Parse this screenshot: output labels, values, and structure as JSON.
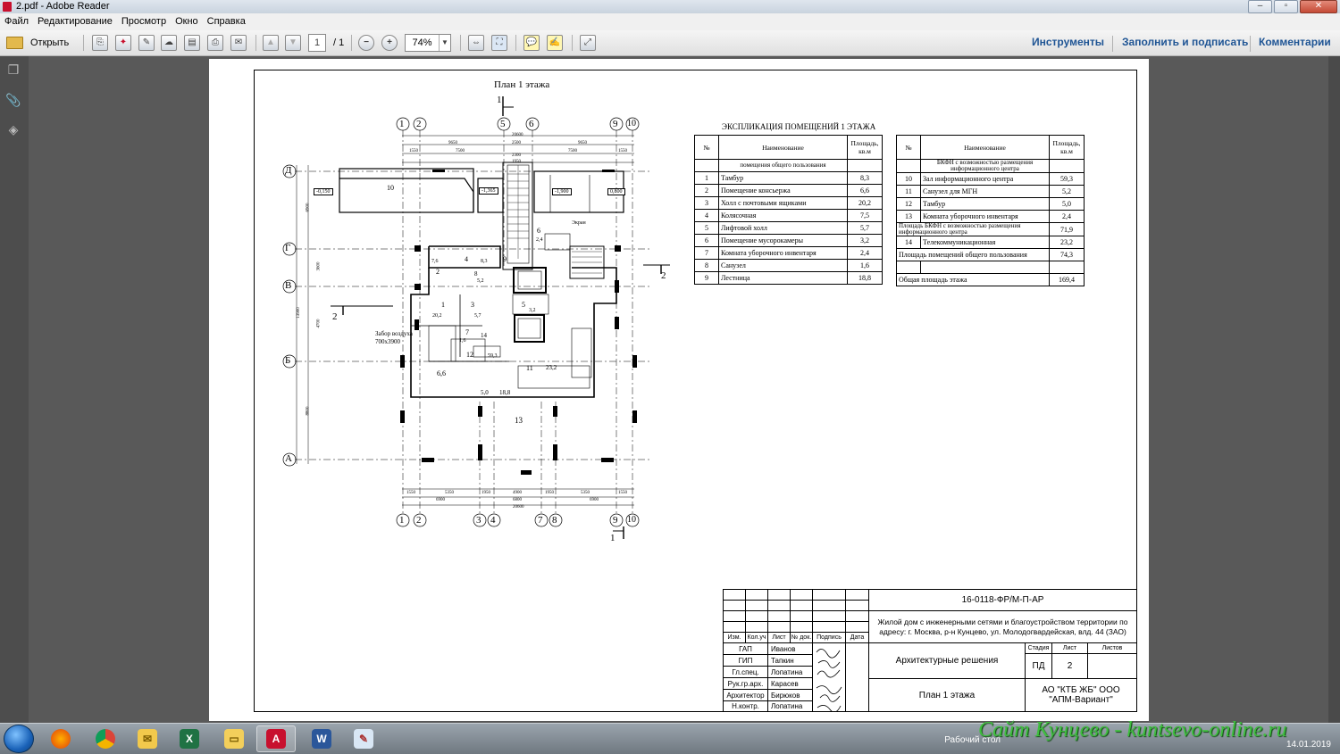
{
  "window": {
    "title": "2.pdf - Adobe Reader",
    "min": "–",
    "max": "▫",
    "close": "✕"
  },
  "menu": [
    "Файл",
    "Редактирование",
    "Просмотр",
    "Окно",
    "Справка"
  ],
  "toolbar": {
    "open_label": "Открыть",
    "page_current": "1",
    "page_total": "/ 1",
    "zoom": "74%",
    "tools_label": "Инструменты",
    "fill_sign_label": "Заполнить и подписать",
    "comments_label": "Комментарии"
  },
  "plan": {
    "title": "План 1 этажа",
    "section_mark": "1",
    "section_mark_2": "2",
    "axes_top": [
      "1",
      "2",
      "5",
      "6",
      "9",
      "10"
    ],
    "axes_bottom": [
      "1",
      "2",
      "3",
      "4",
      "7",
      "8",
      "9",
      "10"
    ],
    "axes_left": [
      "Д",
      "Г",
      "В",
      "Б",
      "А"
    ],
    "dims_top": [
      "20600",
      "2500",
      "9650",
      "9650",
      "2500",
      "7500",
      "7500",
      "2300",
      "1950",
      "1550",
      "1550"
    ],
    "dims_bottom": [
      "1550",
      "5350",
      "1950",
      "4900",
      "1950",
      "5350",
      "1550",
      "6900",
      "6800",
      "6900",
      "20600"
    ],
    "dims_left": [
      "6900",
      "3600",
      "4700",
      "13900",
      "8800"
    ],
    "room_labels": [
      "10",
      "-0,150",
      "-1,365",
      "-1,900",
      "0,800",
      "1",
      "2",
      "3",
      "4",
      "5",
      "6",
      "7",
      "8",
      "9",
      "11",
      "12",
      "13",
      "14",
      "6,6",
      "7,6",
      "8,3",
      "20,2",
      "5,7",
      "3,2",
      "2,4",
      "1,6",
      "5,2",
      "59,3",
      "23,2",
      "5,0",
      "18,8"
    ],
    "note": "Забор воздуха 700x3900",
    "note2": "Экран"
  },
  "explication": {
    "title": "ЭКСПЛИКАЦИЯ ПОМЕЩЕНИЙ 1 ЭТАЖА",
    "headers": [
      "№",
      "Наименование",
      "Площадь, кв.м"
    ],
    "left_section": "помещения общего пользования",
    "left_rows": [
      [
        "1",
        "Тамбур",
        "8,3"
      ],
      [
        "2",
        "Помещение консьержа",
        "6,6"
      ],
      [
        "3",
        "Холл с почтовыми ящиками",
        "20,2"
      ],
      [
        "4",
        "Колясочная",
        "7,5"
      ],
      [
        "5",
        "Лифтовой холл",
        "5,7"
      ],
      [
        "6",
        "Помещение мусорокамеры",
        "3,2"
      ],
      [
        "7",
        "Комната уборочного инвентаря",
        "2,4"
      ],
      [
        "8",
        "Санузел",
        "1,6"
      ],
      [
        "9",
        "Лестница",
        "18,8"
      ]
    ],
    "right_section": "БКФН с возможностью размещения информационного центра",
    "right_rows": [
      [
        "10",
        "Зал информационного центра",
        "59,3"
      ],
      [
        "11",
        "Санузел для МГН",
        "5,2"
      ],
      [
        "12",
        "Тамбур",
        "5,0"
      ],
      [
        "13",
        "Комната уборочного инвентаря",
        "2,4"
      ]
    ],
    "bkfn_total_label": "Площадь БКФН с возможностью размещения информационного центра",
    "bkfn_total": "71,9",
    "row14": [
      "14",
      "Телекоммуникационная",
      "23,2"
    ],
    "common_total_label": "Площадь помещений общего пользования",
    "common_total": "74,3",
    "floor_total_label": "Общая площадь этажа",
    "floor_total": "169,4"
  },
  "stamp": {
    "code": "16-0118-ФР/М-П-АР",
    "object": "Жилой дом с инженерными сетями и благоустройством территории по адресу: г. Москва, р-н Кунцево, ул. Молодогвардейская, влд. 44 (ЗАО)",
    "headers": [
      "Изм.",
      "Кол.уч",
      "Лист",
      "№ док.",
      "Подпись",
      "Дата"
    ],
    "people": [
      [
        "ГАП",
        "Иванов"
      ],
      [
        "ГИП",
        "Тапкин"
      ],
      [
        "Гл.спец.",
        "Лопатина"
      ],
      [
        "Рук.гр.арх.",
        "Карасев"
      ],
      [
        "Архитектор",
        "Бирюков"
      ],
      [
        "Н.контр.",
        "Лопатина"
      ]
    ],
    "section": "Архитектурные решения",
    "stage_h": "Стадия",
    "sheet_h": "Лист",
    "sheets_h": "Листов",
    "stage": "ПД",
    "sheet": "2",
    "sheet_title": "План 1 этажа",
    "org": "АО \"КТБ ЖБ\" ООО \"АПМ-Вариант\""
  },
  "taskbar": {
    "apps": [
      "Firefox",
      "Chrome",
      "Почта",
      "Excel",
      "Проводник",
      "Adobe Reader",
      "Word",
      "Paint"
    ],
    "desktop_label": "Рабочий стол",
    "date": "14.01.2019"
  },
  "watermark": "Сайт Кунцево - kuntsevo-online.ru"
}
